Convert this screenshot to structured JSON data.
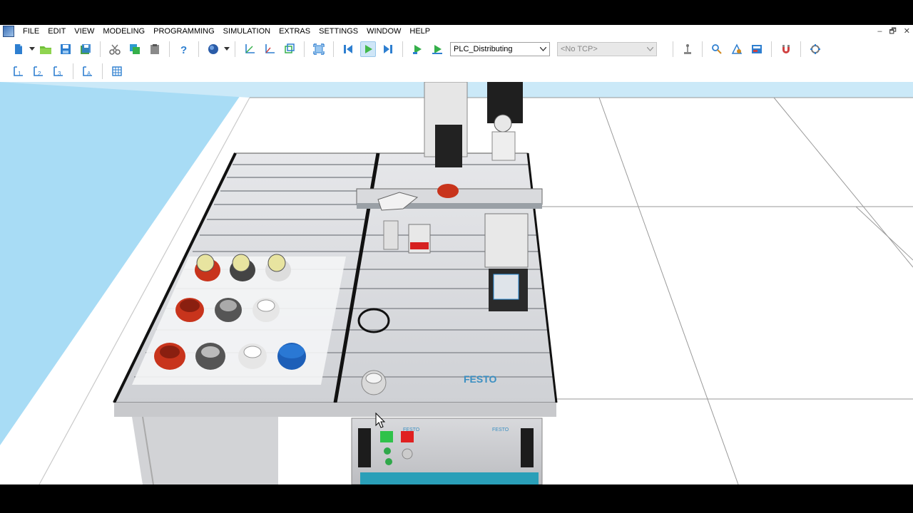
{
  "menu": {
    "items": [
      "FILE",
      "EDIT",
      "VIEW",
      "MODELING",
      "PROGRAMMING",
      "SIMULATION",
      "EXTRAS",
      "SETTINGS",
      "WINDOW",
      "HELP"
    ],
    "window_controls": [
      "–",
      "🗗",
      "✕"
    ]
  },
  "toolbar": {
    "program_select": "PLC_Distributing",
    "tcp_select": "<No TCP>"
  },
  "scene": {
    "brand_label": "FESTO",
    "panel_brand_left": "FESTO",
    "panel_brand_right": "FESTO"
  },
  "colors": {
    "sky": "#a8dcf5",
    "floor": "#ffffff",
    "accent": "#2f8fd8",
    "festo_blue": "#3a8fc2"
  }
}
